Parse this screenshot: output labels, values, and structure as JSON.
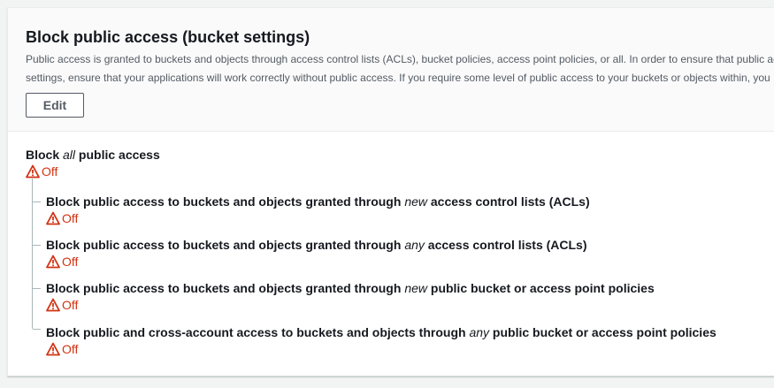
{
  "section": {
    "title": "Block public access (bucket settings)",
    "description_line1": "Public access is granted to buckets and objects through access control lists (ACLs), bucket policies, access point policies, or all. In order to ensure that public acc",
    "description_line2": "settings, ensure that your applications will work correctly without public access. If you require some level of public access to your buckets or objects within, you",
    "edit_label": "Edit"
  },
  "settings": {
    "master": {
      "label_pre": "Block ",
      "label_em": "all",
      "label_post": " public access",
      "status": "Off"
    },
    "children": [
      {
        "label_pre": "Block public access to buckets and objects granted through ",
        "label_em": "new",
        "label_post": " access control lists (ACLs)",
        "status": "Off"
      },
      {
        "label_pre": "Block public access to buckets and objects granted through ",
        "label_em": "any",
        "label_post": " access control lists (ACLs)",
        "status": "Off"
      },
      {
        "label_pre": "Block public access to buckets and objects granted through ",
        "label_em": "new",
        "label_post": " public bucket or access point policies",
        "status": "Off"
      },
      {
        "label_pre": "Block public and cross-account access to buckets and objects through ",
        "label_em": "any",
        "label_post": " public bucket or access point policies",
        "status": "Off"
      }
    ]
  },
  "icons": {
    "status_icon": "warning-triangle-icon"
  },
  "colors": {
    "warning": "#d13212",
    "text": "#16191f",
    "secondary_text": "#545b64"
  }
}
